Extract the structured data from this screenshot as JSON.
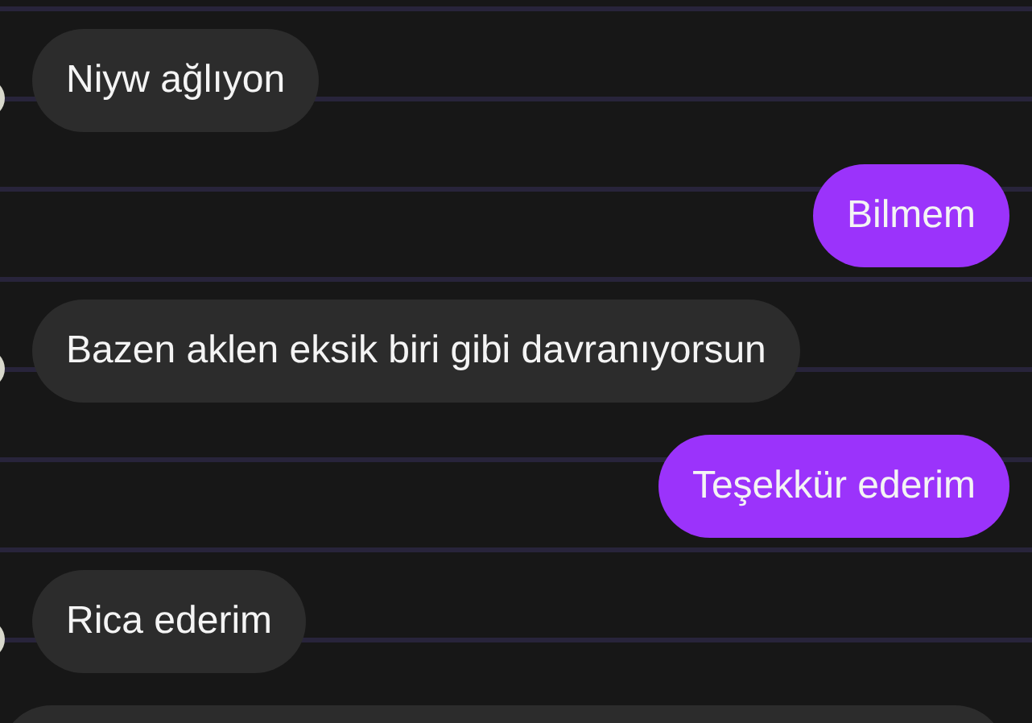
{
  "messages": [
    {
      "kind": "incoming",
      "text": "Niyw ağlıyon"
    },
    {
      "kind": "outgoing",
      "text": "Bilmem"
    },
    {
      "kind": "incoming",
      "text": "Bazen aklen eksik biri gibi davranıyorsun"
    },
    {
      "kind": "outgoing",
      "text": "Teşekkür ederim"
    },
    {
      "kind": "incoming",
      "text": "Rica ederim"
    },
    {
      "kind": "incoming"
    }
  ]
}
